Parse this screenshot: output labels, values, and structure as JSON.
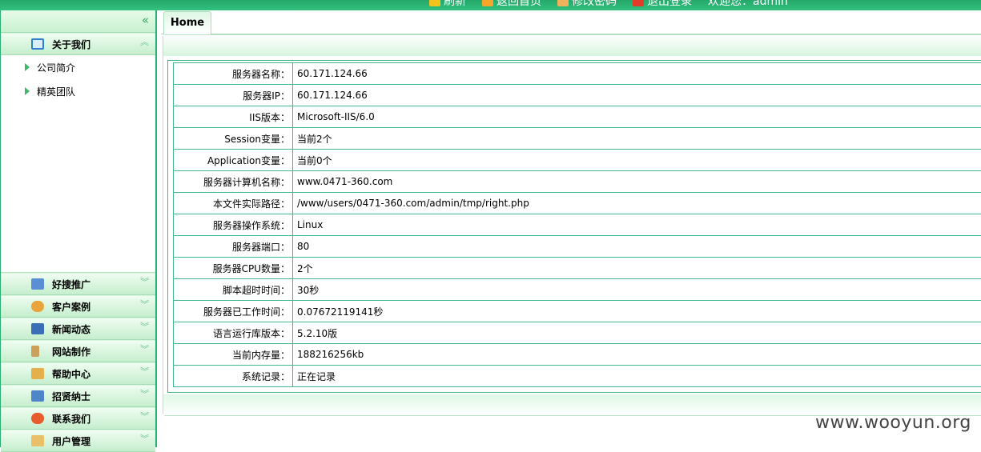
{
  "header": {
    "links": [
      {
        "label": "刷新",
        "icon": "refresh-icon",
        "color": "#f3c21d"
      },
      {
        "label": "返回首页",
        "icon": "home-icon",
        "color": "#f4a52a"
      },
      {
        "label": "修改密码",
        "icon": "pencil-icon",
        "color": "#f0b25a"
      },
      {
        "label": "退出登录",
        "icon": "logout-icon",
        "color": "#e23b2b"
      }
    ],
    "welcome": "欢迎您：admin"
  },
  "sidebar": {
    "collapse_icon": "«",
    "open_section": {
      "label": "关于我们",
      "icon": "window-icon",
      "arrow": "︽"
    },
    "sub_items": [
      "公司简介",
      "精英团队"
    ],
    "sections": [
      {
        "label": "好搜推广",
        "icon": "card-icon"
      },
      {
        "label": "客户案例",
        "icon": "user-icon"
      },
      {
        "label": "新闻动态",
        "icon": "book-icon"
      },
      {
        "label": "网站制作",
        "icon": "tool-icon"
      },
      {
        "label": "帮助中心",
        "icon": "edit-icon"
      },
      {
        "label": "招贤纳士",
        "icon": "grid-icon"
      },
      {
        "label": "联系我们",
        "icon": "star-icon"
      },
      {
        "label": "用户管理",
        "icon": "folder-icon"
      }
    ],
    "collapsed_arrow": "︾"
  },
  "tabs": [
    {
      "label": "Home"
    }
  ],
  "server_info": [
    {
      "key": "服务器名称：",
      "value": "60.171.124.66"
    },
    {
      "key": "服务器IP：",
      "value": "60.171.124.66"
    },
    {
      "key": "IIS版本：",
      "value": "Microsoft-IIS/6.0"
    },
    {
      "key": "Session变量：",
      "value": "当前2个"
    },
    {
      "key": "Application变量：",
      "value": "当前0个"
    },
    {
      "key": "服务器计算机名称：",
      "value": "www.0471-360.com"
    },
    {
      "key": "本文件实际路径：",
      "value": "/www/users/0471-360.com/admin/tmp/right.php"
    },
    {
      "key": "服务器操作系统：",
      "value": "Linux"
    },
    {
      "key": "服务器端口：",
      "value": "80"
    },
    {
      "key": "服务器CPU数量：",
      "value": "2个"
    },
    {
      "key": "脚本超时时间：",
      "value": "30秒"
    },
    {
      "key": "服务器已工作时间：",
      "value": "0.07672119141秒"
    },
    {
      "key": "语言运行库版本：",
      "value": "5.2.10版"
    },
    {
      "key": "当前内存量：",
      "value": "188216256kb"
    },
    {
      "key": "系统记录：",
      "value": "正在记录"
    }
  ],
  "watermark": "www.wooyun.org",
  "colors": {
    "accent": "#2ab072",
    "border": "#3fb989"
  }
}
